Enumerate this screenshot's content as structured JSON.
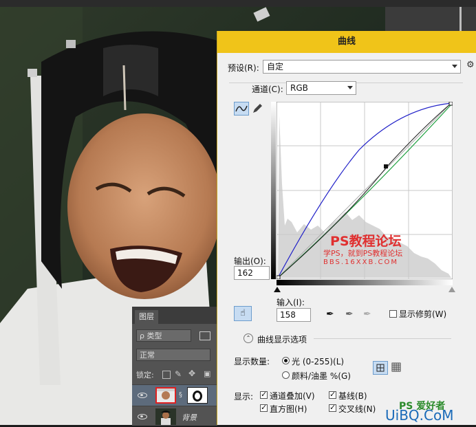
{
  "topbar": {
    "text": ""
  },
  "layers_panel": {
    "tab_label": "图层",
    "filter_label": "ρ 类型",
    "blend_mode": "正常",
    "lock_label": "锁定:",
    "background_layer_label": "背景"
  },
  "dialog": {
    "title": "曲线",
    "preset_label": "预设(R):",
    "preset_value": "自定",
    "channel_label": "通道(C):",
    "channel_value": "RGB",
    "output_label": "输出(O):",
    "output_value": "162",
    "input_label": "输入(I):",
    "input_value": "158",
    "show_clipping_label": "显示修剪(W)",
    "display_options_label": "曲线显示选项",
    "show_amount_label": "显示数量:",
    "light_option": "光 (0-255)(L)",
    "pigment_option": "颜料/油墨 %(G)",
    "show_label": "显示:",
    "channel_overlays": "通道叠加(V)",
    "baseline": "基线(B)",
    "histogram": "直方图(H)",
    "intersection_line": "交叉线(N)"
  },
  "watermarks": {
    "main": "PS教程论坛",
    "sub": "学PS，就到PS教程论坛",
    "url": "BBS.16XXB.COM",
    "corner_logo": "PS 爱好者",
    "corner_site": "UiBQ.CoM"
  },
  "colors": {
    "dialog_title": "#f0c419",
    "curve_rgb": "#1a1a1a",
    "curve_blue": "#2020c8",
    "curve_green": "#20a040",
    "watermark": "#e03030"
  }
}
